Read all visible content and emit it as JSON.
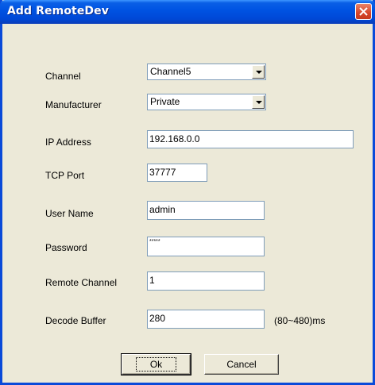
{
  "window": {
    "title": "Add RemoteDev"
  },
  "form": {
    "channel": {
      "label": "Channel",
      "value": "Channel5"
    },
    "manufacturer": {
      "label": "Manufacturer",
      "value": "Private"
    },
    "ip_address": {
      "label": "IP Address",
      "value": "192.168.0.0"
    },
    "tcp_port": {
      "label": "TCP Port",
      "value": "37777"
    },
    "user_name": {
      "label": "User Name",
      "value": "admin"
    },
    "password": {
      "label": "Password",
      "value": "*****"
    },
    "remote_channel": {
      "label": "Remote Channel",
      "value": "1"
    },
    "decode_buffer": {
      "label": "Decode Buffer",
      "value": "280",
      "suffix": "(80~480)ms"
    }
  },
  "buttons": {
    "ok": "Ok",
    "cancel": "Cancel"
  },
  "colors": {
    "titlebar": "#0054e3",
    "dialog_bg": "#ece9d8",
    "close": "#d6452a"
  }
}
